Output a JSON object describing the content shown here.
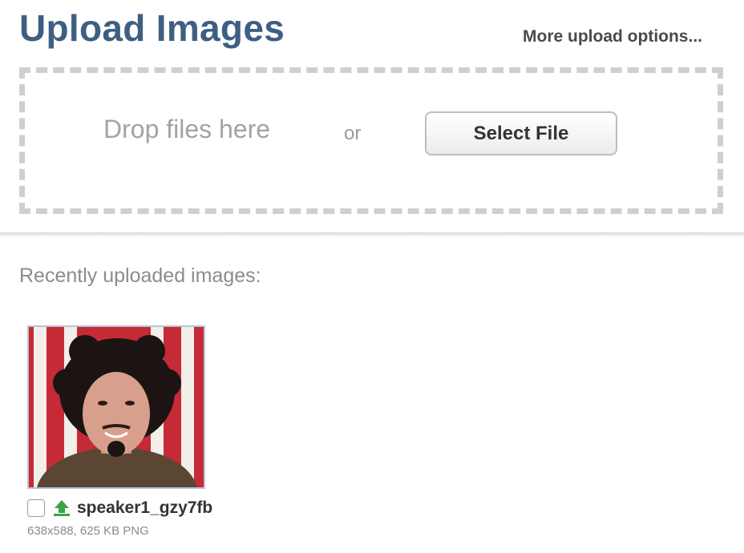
{
  "header": {
    "title": "Upload Images",
    "more_options": "More upload options..."
  },
  "dropzone": {
    "drop_text": "Drop files here",
    "or_text": "or",
    "select_button": "Select File"
  },
  "recent": {
    "label": "Recently uploaded images:",
    "items": [
      {
        "filename": "speaker1_gzy7fb",
        "meta": "638x588, 625 KB PNG",
        "checked": false,
        "icon": "upload-arrow-icon",
        "thumbnail": "portrait-photo"
      }
    ]
  },
  "colors": {
    "title": "#3e5f82",
    "dashed_border": "#cfcfcf",
    "upload_icon": "#3aa34a"
  }
}
